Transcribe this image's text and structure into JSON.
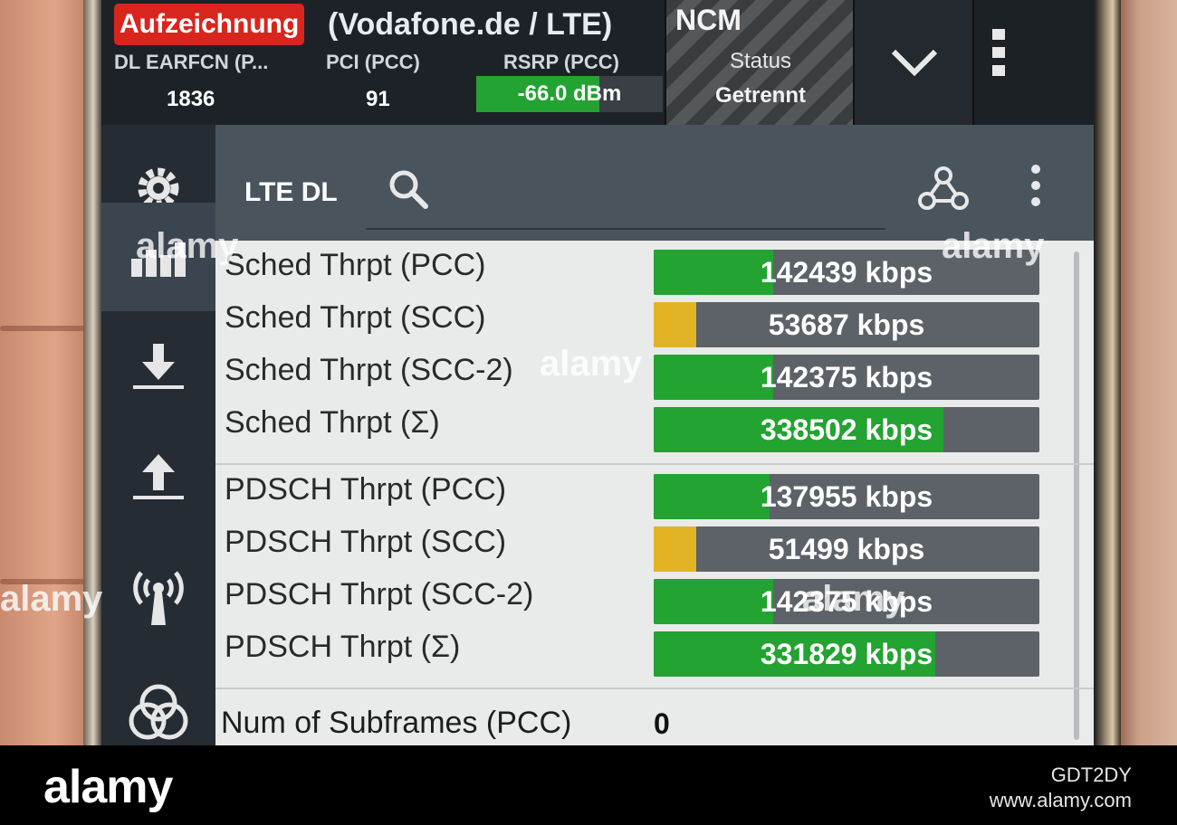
{
  "status_bar": {
    "recording_label": "Aufzeichnung",
    "network_label": "(Vodafone.de / LTE)",
    "columns": [
      {
        "header": "DL EARFCN (P...",
        "value": "1836"
      },
      {
        "header": "PCI (PCC)",
        "value": "91"
      },
      {
        "header": "RSRP (PCC)",
        "value": "-66.0 dBm",
        "fill_fraction": 0.66
      }
    ],
    "ncm": {
      "title": "NCM",
      "status_label": "Status",
      "status_value": "Getrennt"
    },
    "colors": {
      "record": "#d8261f",
      "good": "#23a331",
      "warn": "#e2b324"
    }
  },
  "sidebar": {
    "items": [
      {
        "icon": "gear-icon"
      },
      {
        "icon": "bar-chart-icon"
      },
      {
        "icon": "download-icon"
      },
      {
        "icon": "upload-icon"
      },
      {
        "icon": "antenna-icon"
      },
      {
        "icon": "venn-icon"
      }
    ]
  },
  "panel": {
    "title": "LTE DL",
    "search_icon": "search-icon",
    "webhook_icon": "webhook-icon",
    "rows": [
      {
        "label": "Sched Thrpt (PCC)",
        "value": "142439 kbps",
        "fill_fraction": 0.31,
        "color": "#23a331"
      },
      {
        "label": "Sched Thrpt (SCC)",
        "value": "53687 kbps",
        "fill_fraction": 0.11,
        "color": "#e2b324"
      },
      {
        "label": "Sched Thrpt (SCC-2)",
        "value": "142375 kbps",
        "fill_fraction": 0.31,
        "color": "#23a331"
      },
      {
        "label": "Sched Thrpt (Σ)",
        "value": "338502 kbps",
        "fill_fraction": 0.75,
        "color": "#23a331"
      },
      {
        "label": "PDSCH Thrpt (PCC)",
        "value": "137955 kbps",
        "fill_fraction": 0.3,
        "color": "#23a331"
      },
      {
        "label": "PDSCH Thrpt (SCC)",
        "value": "51499 kbps",
        "fill_fraction": 0.11,
        "color": "#e2b324"
      },
      {
        "label": "PDSCH Thrpt (SCC-2)",
        "value": "142375 kbps",
        "fill_fraction": 0.31,
        "color": "#23a331"
      },
      {
        "label": "PDSCH Thrpt (Σ)",
        "value": "331829 kbps",
        "fill_fraction": 0.73,
        "color": "#23a331"
      }
    ],
    "subframes": {
      "label": "Num of Subframes (PCC)",
      "value": "0"
    }
  },
  "watermark": {
    "logo": "alamy",
    "image_id": "GDT2DY",
    "url": "www.alamy.com"
  }
}
